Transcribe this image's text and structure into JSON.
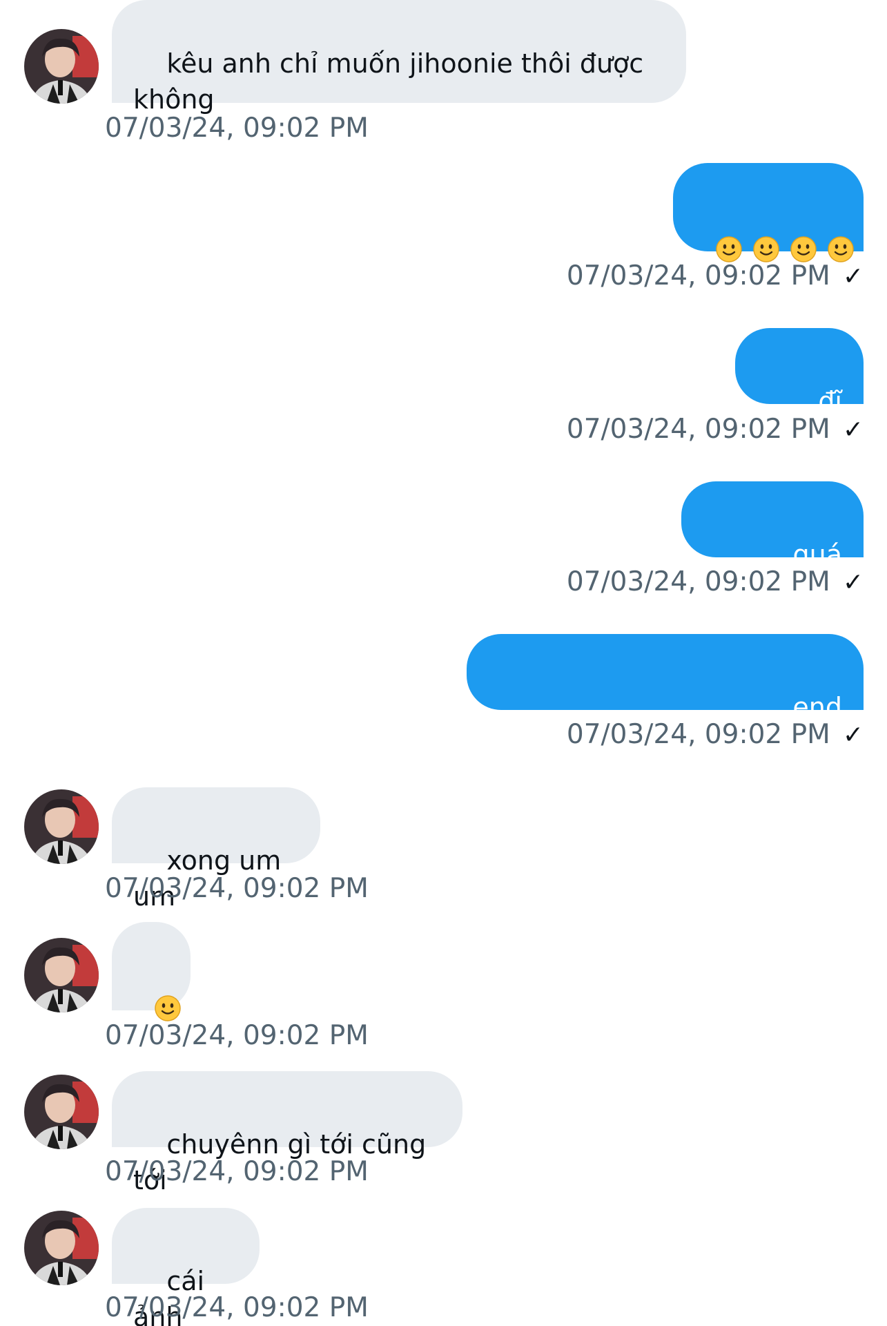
{
  "messages": [
    {
      "direction": "in",
      "text": "kêu anh chỉ muốn jihoonie thôi được\nkhông",
      "timestamp": "07/03/24, 09:02 PM"
    },
    {
      "direction": "out",
      "emoji_count": 4,
      "emoji": "slightly-smiling-face-icon",
      "timestamp": "07/03/24, 09:02 PM",
      "status": "✓"
    },
    {
      "direction": "out",
      "text": "đĩ mẹ",
      "timestamp": "07/03/24, 09:02 PM",
      "status": "✓"
    },
    {
      "direction": "out",
      "text": "quá shock",
      "timestamp": "07/03/24, 09:02 PM",
      "status": "✓"
    },
    {
      "direction": "out",
      "text": "ẹnd djendnamamamznnxx",
      "timestamp": "07/03/24, 09:02 PM",
      "status": "✓"
    },
    {
      "direction": "in",
      "text": "xong um um",
      "timestamp": "07/03/24, 09:02 PM"
    },
    {
      "direction": "in",
      "emoji_count": 1,
      "emoji": "slightly-smiling-face-icon",
      "timestamp": "07/03/24, 09:02 PM"
    },
    {
      "direction": "in",
      "text": "chuyênn gì tới cũng tới",
      "timestamp": "07/03/24, 09:02 PM"
    },
    {
      "direction": "in",
      "text": "cái ảnh",
      "timestamp": "07/03/24, 09:02 PM"
    }
  ],
  "colors": {
    "incoming_bubble": "#e8ecf0",
    "outgoing_bubble": "#1d9bf0",
    "timestamp_text": "#536471",
    "emoji_yellow": "#ffc83d"
  }
}
